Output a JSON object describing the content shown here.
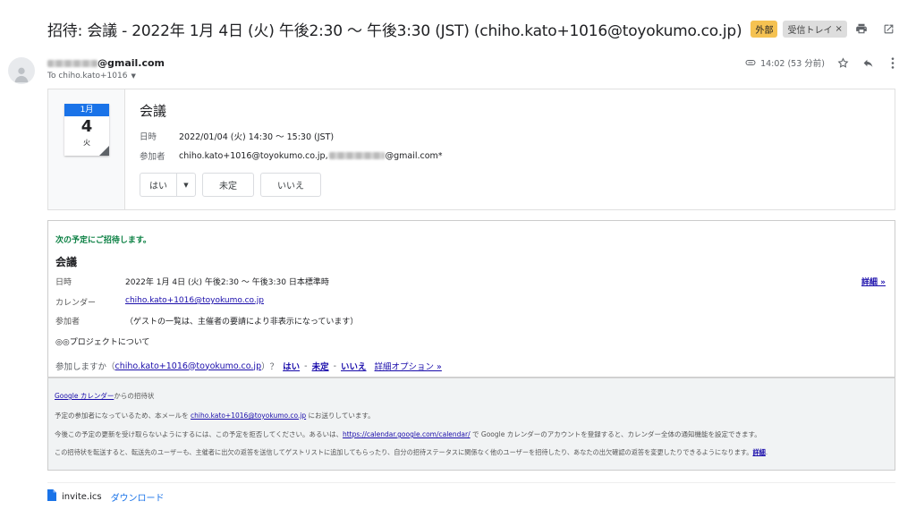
{
  "email": {
    "subject": "招待: 会議 - 2022年 1月 4日 (火) 午後2:30 〜 午後3:30 (JST) (chiho.kato+1016@toyokumo.co.jp)",
    "labels": {
      "external": "外部",
      "inbox": "受信トレイ",
      "inbox_close": "×"
    },
    "sender_suffix": "@gmail.com",
    "to_line": "To chiho.kato+1016",
    "time": "14:02 (53 分前)"
  },
  "card": {
    "month": "1月",
    "day": "4",
    "weekday": "火",
    "title": "会議",
    "date_label": "日時",
    "date_value": "2022/01/04 (火) 14:30 〜 15:30 (JST)",
    "guests_label": "参加者",
    "guests_value_prefix": "chiho.kato+1016@toyokumo.co.jp,",
    "guests_value_suffix": "@gmail.com*",
    "rsvp": {
      "yes": "はい",
      "maybe": "未定",
      "no": "いいえ"
    }
  },
  "invite": {
    "heading": "次の予定にご招待します。",
    "title": "会議",
    "date_label": "日時",
    "date_value": "2022年 1月 4日 (火) 午後2:30 〜 午後3:30 日本標準時",
    "detail_link": "詳細 »",
    "calendar_label": "カレンダー",
    "calendar_value": "chiho.kato+1016@toyokumo.co.jp",
    "guests_label": "参加者",
    "guests_value": "（ゲストの一覧は、主催者の要請により非表示になっています）",
    "description": "◎◎プロジェクトについて",
    "attend_prefix": "参加しますか（",
    "attend_email": "chiho.kato+1016@toyokumo.co.jp",
    "attend_suffix": "）？",
    "yes": "はい",
    "maybe": "未定",
    "no": "いいえ",
    "separator": "-",
    "more_options": "詳細オプション »"
  },
  "footer": {
    "line1_link": "Google カレンダー",
    "line1_rest": "からの招待状",
    "line2_prefix": "予定の参加者になっているため、本メールを ",
    "line2_email": "chiho.kato+1016@toyokumo.co.jp",
    "line2_suffix": " にお送りしています。",
    "line3_prefix": "今後この予定の更新を受け取らないようにするには、この予定を拒否してください。あるいは、",
    "line3_url": "https://calendar.google.com/calendar/",
    "line3_suffix": " で Google カレンダーのアカウントを登録すると、カレンダー全体の通知機能を設定できます。",
    "line4_text": "この招待状を転送すると、転送先のユーザーも、主催者に出欠の返答を送信してゲストリストに追加してもらったり、自分の招待ステータスに関係なく他のユーザーを招待したり、あなたの出欠確認の返答を変更したりできるようになります。",
    "line4_link": "詳細",
    "line4_end": "."
  },
  "attachment": {
    "name": "invite.ics",
    "download": "ダウンロード"
  },
  "colors": {
    "accent": "#1a73e8",
    "external_chip": "#f5c252",
    "invite_heading": "#0b8043",
    "link": "#1a0dab"
  }
}
